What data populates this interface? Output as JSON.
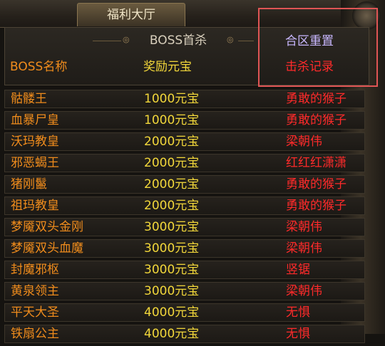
{
  "window": {
    "title": "福利大厅"
  },
  "section": {
    "title": "BOSS首杀"
  },
  "headers": {
    "boss_name": "BOSS名称",
    "reward": "奖励元宝"
  },
  "buttons": {
    "reset": "合区重置",
    "kill_log": "击杀记录"
  },
  "colors": {
    "boss": "#f08c1c",
    "reward": "#f2d73a",
    "killer": "#ff2a2a",
    "reset": "#c9b8ff",
    "kill_log": "#ff2a2a"
  },
  "rows": [
    {
      "boss": "骷髅王",
      "reward": "1000元宝",
      "killer": "勇敢的猴子"
    },
    {
      "boss": "血暴尸皇",
      "reward": "1000元宝",
      "killer": "勇敢的猴子"
    },
    {
      "boss": "沃玛教皇",
      "reward": "2000元宝",
      "killer": "梁朝伟"
    },
    {
      "boss": "邪恶蝎王",
      "reward": "2000元宝",
      "killer": "红红红潇潇"
    },
    {
      "boss": "猪刚鬣",
      "reward": "2000元宝",
      "killer": "勇敢的猴子"
    },
    {
      "boss": "祖玛教皇",
      "reward": "2000元宝",
      "killer": "勇敢的猴子"
    },
    {
      "boss": "梦魇双头金刚",
      "reward": "3000元宝",
      "killer": "梁朝伟"
    },
    {
      "boss": "梦魇双头血魔",
      "reward": "3000元宝",
      "killer": "梁朝伟"
    },
    {
      "boss": "封魔邪枢",
      "reward": "3000元宝",
      "killer": "竖锯"
    },
    {
      "boss": "黄泉领主",
      "reward": "3000元宝",
      "killer": "梁朝伟"
    },
    {
      "boss": "平天大圣",
      "reward": "4000元宝",
      "killer": "无惧"
    },
    {
      "boss": "铁扇公主",
      "reward": "4000元宝",
      "killer": "无惧"
    }
  ]
}
